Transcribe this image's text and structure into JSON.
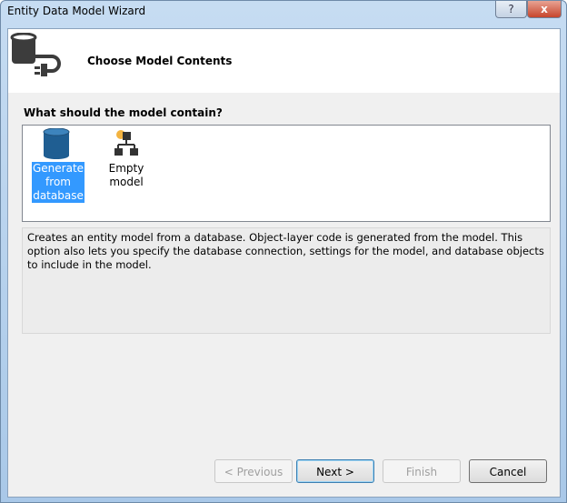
{
  "window": {
    "title": "Entity Data Model Wizard",
    "help_label": "?",
    "close_label": "x"
  },
  "header": {
    "title": "Choose Model Contents"
  },
  "question": "What should the model contain?",
  "options": [
    {
      "label": "Generate from database",
      "selected": true
    },
    {
      "label": "Empty model",
      "selected": false
    }
  ],
  "description": "Creates an entity model from a database. Object-layer code is generated from the model. This option also lets you specify the database connection, settings for the model, and database objects to include in the model.",
  "buttons": {
    "previous": "< Previous",
    "next": "Next >",
    "finish": "Finish",
    "cancel": "Cancel"
  },
  "colors": {
    "selection": "#3399ff"
  }
}
